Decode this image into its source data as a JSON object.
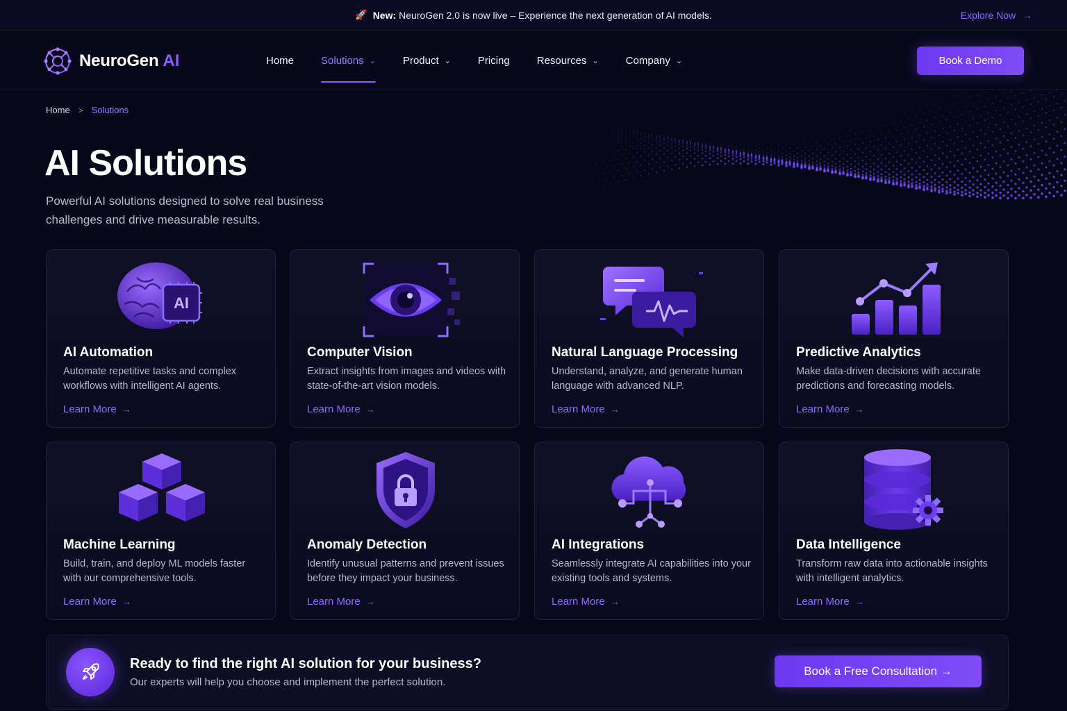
{
  "announcement": {
    "icon": "rocket-icon",
    "label": "New:",
    "text": "NeuroGen 2.0 is now live – Experience the next generation of AI models.",
    "link": "Explore Now",
    "link_arrow": "→"
  },
  "brand": {
    "name": "NeuroGen",
    "suffix": "AI",
    "accent": "#8b5cf6"
  },
  "nav": {
    "items": [
      {
        "label": "Home",
        "dropdown": false,
        "active": false
      },
      {
        "label": "Solutions",
        "dropdown": true,
        "active": true
      },
      {
        "label": "Product",
        "dropdown": true,
        "active": false
      },
      {
        "label": "Pricing",
        "dropdown": false,
        "active": false
      },
      {
        "label": "Resources",
        "dropdown": true,
        "active": false
      },
      {
        "label": "Company",
        "dropdown": true,
        "active": false
      }
    ],
    "cta": "Book a Demo"
  },
  "breadcrumb": {
    "home": "Home",
    "separator": ">",
    "current": "Solutions"
  },
  "hero": {
    "title": "AI Solutions",
    "subtitle": "Powerful AI solutions designed to solve real business challenges and drive measurable results."
  },
  "cards": [
    {
      "icon": "brain-chip-icon",
      "title": "AI Automation",
      "desc": "Automate repetitive tasks and complex workflows with intelligent AI agents.",
      "link": "Learn More",
      "chip_text": "AI"
    },
    {
      "icon": "eye-icon",
      "title": "Computer Vision",
      "desc": "Extract insights from images and videos with state-of-the-art vision models.",
      "link": "Learn More"
    },
    {
      "icon": "chat-bubbles-icon",
      "title": "Natural Language Processing",
      "desc": "Understand, analyze, and generate human language with advanced NLP.",
      "link": "Learn More"
    },
    {
      "icon": "bar-chart-icon",
      "title": "Predictive Analytics",
      "desc": "Make data-driven decisions with accurate predictions and forecasting models.",
      "link": "Learn More"
    },
    {
      "icon": "cubes-icon",
      "title": "Machine Learning",
      "desc": "Build, train, and deploy ML models faster with our comprehensive tools.",
      "link": "Learn More"
    },
    {
      "icon": "shield-lock-icon",
      "title": "Anomaly Detection",
      "desc": "Identify unusual patterns and prevent issues before they impact your business.",
      "link": "Learn More"
    },
    {
      "icon": "cloud-network-icon",
      "title": "AI Integrations",
      "desc": "Seamlessly integrate AI capabilities into your existing tools and systems.",
      "link": "Learn More"
    },
    {
      "icon": "database-gear-icon",
      "title": "Data Intelligence",
      "desc": "Transform raw data into actionable insights with intelligent analytics.",
      "link": "Learn More"
    }
  ],
  "link_arrow": "→",
  "cta": {
    "icon": "rocket-icon",
    "heading": "Ready to find the right AI solution for your business?",
    "sub": "Our experts will help you choose and implement the perfect solution.",
    "button": "Book a Free Consultation →"
  },
  "colors": {
    "background": "#07071a",
    "accent": "#8b5cf6",
    "link": "#8f6bff",
    "button": "#6d38f0"
  }
}
